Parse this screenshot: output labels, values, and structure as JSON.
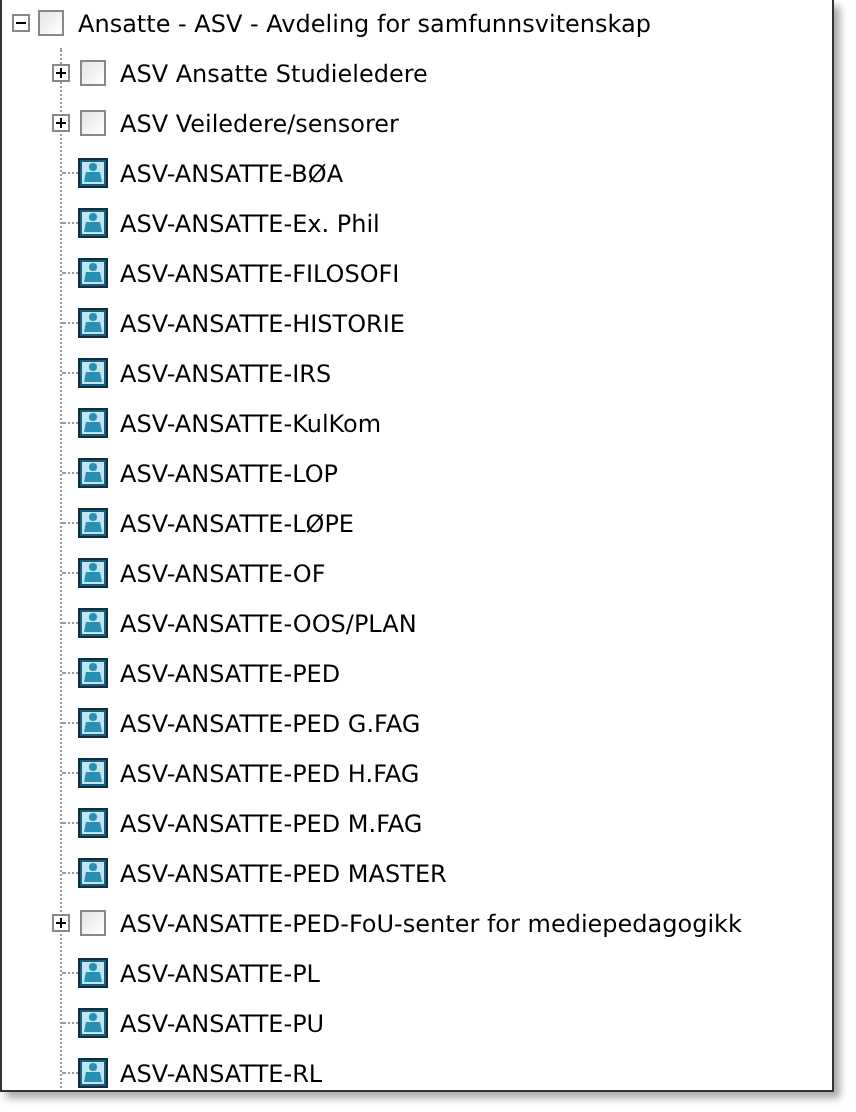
{
  "tree": {
    "label": "Ansatte - ASV - Avdeling for samfunnsvitenskap",
    "kind": "group",
    "expanded": true,
    "checked": false,
    "children": [
      {
        "label": "ASV Ansatte Studieledere",
        "kind": "group",
        "expanded": false,
        "checked": false
      },
      {
        "label": "ASV Veiledere/sensorer",
        "kind": "group",
        "expanded": false,
        "checked": false
      },
      {
        "label": "ASV-ANSATTE-BØA",
        "kind": "user"
      },
      {
        "label": "ASV-ANSATTE-Ex. Phil",
        "kind": "user"
      },
      {
        "label": "ASV-ANSATTE-FILOSOFI",
        "kind": "user"
      },
      {
        "label": "ASV-ANSATTE-HISTORIE",
        "kind": "user"
      },
      {
        "label": "ASV-ANSATTE-IRS",
        "kind": "user"
      },
      {
        "label": "ASV-ANSATTE-KulKom",
        "kind": "user"
      },
      {
        "label": "ASV-ANSATTE-LOP",
        "kind": "user"
      },
      {
        "label": "ASV-ANSATTE-LØPE",
        "kind": "user"
      },
      {
        "label": "ASV-ANSATTE-OF",
        "kind": "user"
      },
      {
        "label": "ASV-ANSATTE-OOS/PLAN",
        "kind": "user"
      },
      {
        "label": "ASV-ANSATTE-PED",
        "kind": "user"
      },
      {
        "label": "ASV-ANSATTE-PED G.FAG",
        "kind": "user"
      },
      {
        "label": "ASV-ANSATTE-PED H.FAG",
        "kind": "user"
      },
      {
        "label": "ASV-ANSATTE-PED M.FAG",
        "kind": "user"
      },
      {
        "label": "ASV-ANSATTE-PED MASTER",
        "kind": "user"
      },
      {
        "label": "ASV-ANSATTE-PED-FoU-senter for mediepedagogikk",
        "kind": "group",
        "expanded": false,
        "checked": false
      },
      {
        "label": "ASV-ANSATTE-PL",
        "kind": "user"
      },
      {
        "label": "ASV-ANSATTE-PU",
        "kind": "user"
      },
      {
        "label": "ASV-ANSATTE-RL",
        "kind": "user"
      }
    ]
  }
}
